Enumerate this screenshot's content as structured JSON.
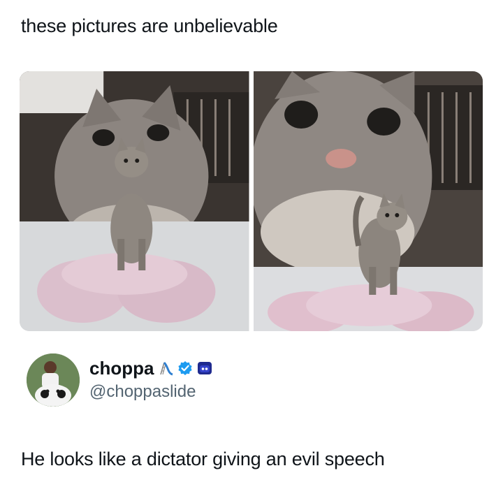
{
  "meme": {
    "caption": "these pictures are unbelievable"
  },
  "photos": [
    {
      "subject": "small tabby cat standing on pink cat tree in front of large cat poster"
    },
    {
      "subject": "close-up of large cat poster with small tabby cat on pink platform"
    }
  ],
  "author": {
    "display_name": "choppa",
    "handle": "@choppaslide",
    "icons": [
      "slide-emoji-icon",
      "verified-badge-icon",
      "blue-robot-emoji-icon"
    ],
    "verified_color": "#1d9bf0"
  },
  "tweet": {
    "text": "He looks like a dictator giving an evil speech"
  }
}
